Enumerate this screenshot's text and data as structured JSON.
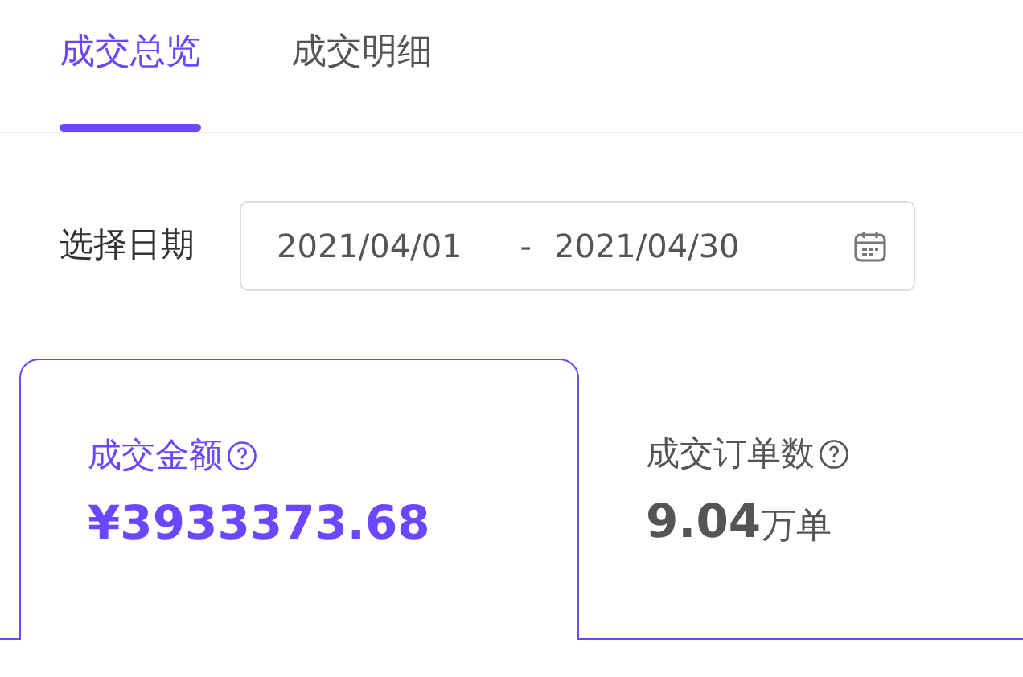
{
  "tabs": [
    {
      "label": "成交总览",
      "selected": true
    },
    {
      "label": "成交明细",
      "selected": false
    }
  ],
  "date_filter": {
    "label": "选择日期",
    "start": "2021/04/01",
    "separator": "-",
    "end": "2021/04/30"
  },
  "metrics": [
    {
      "label": "成交金额",
      "value": "¥3933373.68",
      "selected": true
    },
    {
      "label": "成交订单数",
      "value": "9.04",
      "unit": "万单",
      "selected": false
    }
  ]
}
